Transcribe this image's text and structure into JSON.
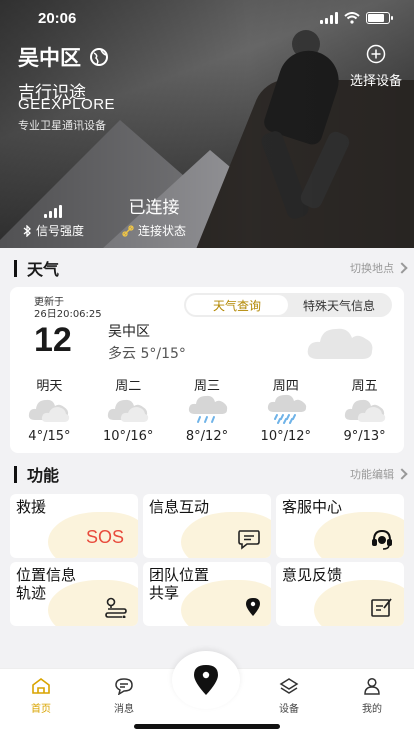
{
  "status_bar": {
    "time": "20:06"
  },
  "hero": {
    "location": "吴中区",
    "brand_cn": "吉行识途",
    "brand_en": "GEEXPLORE",
    "brand_desc": "专业卫星通讯设备",
    "select_device": "选择设备",
    "signal_label": "信号强度",
    "connection_value": "已连接",
    "connection_label": "连接状态"
  },
  "weather_section": {
    "title": "天气",
    "switch_label": "切换地点",
    "updated_label": "更新于",
    "updated_time": "26日20:06:25",
    "tabs": [
      "天气查询",
      "特殊天气信息"
    ],
    "current_temp": "12",
    "location": "吴中区",
    "condition": "多云 5°/15°",
    "forecast": [
      {
        "day": "明天",
        "icon": "cloudy-icon",
        "range": "4°/15°"
      },
      {
        "day": "周二",
        "icon": "cloudy-icon",
        "range": "10°/16°"
      },
      {
        "day": "周三",
        "icon": "light-rain-icon",
        "range": "8°/12°"
      },
      {
        "day": "周四",
        "icon": "rain-icon",
        "range": "10°/12°"
      },
      {
        "day": "周五",
        "icon": "cloudy-icon",
        "range": "9°/13°"
      }
    ]
  },
  "functions_section": {
    "title": "功能",
    "edit_label": "功能编辑",
    "tiles": [
      {
        "label": "救援",
        "badge": "SOS"
      },
      {
        "label": "信息互动",
        "icon": "chat-icon"
      },
      {
        "label": "客服中心",
        "icon": "headset-icon"
      },
      {
        "label": "位置信息\n轨迹",
        "icon": "route-icon"
      },
      {
        "label": "团队位置\n共享",
        "icon": "location-pin-icon"
      },
      {
        "label": "意见反馈",
        "icon": "feedback-icon"
      }
    ]
  },
  "tabbar": {
    "items": [
      "首页",
      "消息",
      "设备",
      "我的"
    ],
    "active": "首页",
    "accent_color": "#d9a400"
  }
}
